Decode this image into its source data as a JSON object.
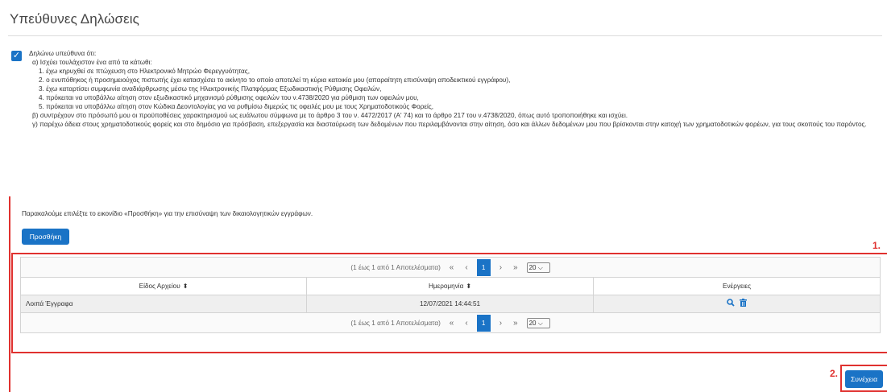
{
  "page": {
    "title": "Υπεύθυνες Δηλώσεις"
  },
  "declaration": {
    "checked": true,
    "lines": [
      "Δηλώνω υπεύθυνα ότι:",
      "α) Ισχύει τουλάχιστον ένα από τα κάτωθι:",
      "1. έχω κηρυχθεί σε πτώχευση στο Ηλεκτρονικό Μητρώο Φερεγγυότητας,",
      "2. ο ενυπόθηκος ή προσημειούχος πιστωτής έχει κατασχέσει το ακίνητο το οποίο αποτελεί τη κύρια κατοικία μου (απαραίτητη επισύναψη αποδεικτικού εγγράφου),",
      "3. έχω καταρτίσει συμφωνία αναδιάρθρωσης μέσω της Ηλεκτρονικής Πλατφόρμας Εξωδικαστικής Ρύθμισης Οφειλών,",
      "4. πρόκειται να υποβάλλω αίτηση στον εξωδικαστικό μηχανισμό ρύθμισης οφειλών του ν.4738/2020 για ρύθμιση των οφειλών μου,",
      "5. πρόκειται να υποβάλλω αίτηση στον Κώδικα Δεοντολογίας για να ρυθμίσω διμερώς τις οφειλές μου με τους Χρηματοδοτικούς Φορείς,",
      "β) συντρέχουν στο πρόσωπό μου οι προϋποθέσεις χαρακτηρισμού ως ευάλωτου σύμφωνα με το άρθρο 3 του ν. 4472/2017 (Α' 74) και το άρθρο 217 του ν.4738/2020, όπως αυτό τροποποιήθηκε και ισχύει.",
      "γ) παρέχω άδεια στους χρηματοδοτικούς φορείς και στο δημόσιο για πρόσβαση, επεξεργασία και διασταύρωση των δεδομένων που περιλαμβάνονται στην αίτηση, όσο και άλλων δεδομένων μου που βρίσκονται στην κατοχή των χρηματοδοτικών φορέων, για τους σκοπούς του παρόντος."
    ]
  },
  "attachments": {
    "hint": "Παρακαλούμε επιλέξτε το εικονίδιο «Προσθήκη» για την επισύναψη των δικαιολογητικών εγγράφων.",
    "add_label": "Προσθήκη",
    "pager": {
      "summary": "(1 έως 1 από 1 Αποτελέσματα)",
      "first": "«",
      "prev": "‹",
      "current": "1",
      "next": "›",
      "last": "»",
      "page_size": "20"
    },
    "columns": [
      "Είδος Αρχείου",
      "Ημερομηνία",
      "Ενέργειες"
    ],
    "rows": [
      {
        "type": "Λοιπά Έγγραφα",
        "date": "12/07/2021 14:44:51"
      }
    ]
  },
  "annotations": {
    "step1": "1.",
    "step2": "2."
  },
  "footer": {
    "next_label": "Συνέχεια"
  },
  "colors": {
    "accent": "#1a73c6",
    "annotation": "#e0312f"
  }
}
